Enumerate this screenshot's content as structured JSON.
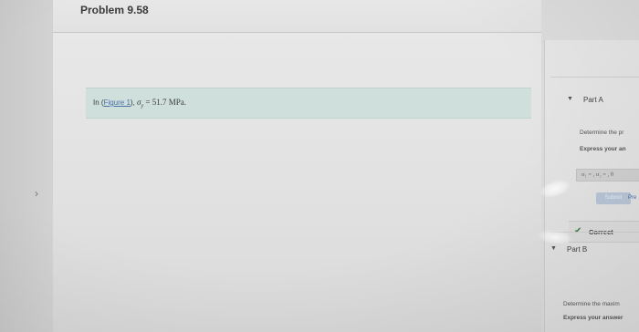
{
  "problem": {
    "title": "Problem 9.58"
  },
  "info": {
    "prefix": "In (",
    "figure_link": "Figure 1",
    "middle": "),",
    "sigma": "σ",
    "sub": "y",
    "equals": " = 51.7 MPa."
  },
  "right_panel": {
    "part_a_label": "Part A",
    "determine_text": "Determine the pr",
    "express_text": "Express your an",
    "symbols_text": "σ₁ =⁡ , σ₂ =⁡ , θ",
    "submit_label": "Submit",
    "prev_link": "Pre",
    "correct_label": "Correct",
    "part_b_label": "Part B",
    "determine_b_text": "Determine the maxim",
    "express_b_text": "Express your answer"
  },
  "nav": {
    "chevron": "›"
  }
}
